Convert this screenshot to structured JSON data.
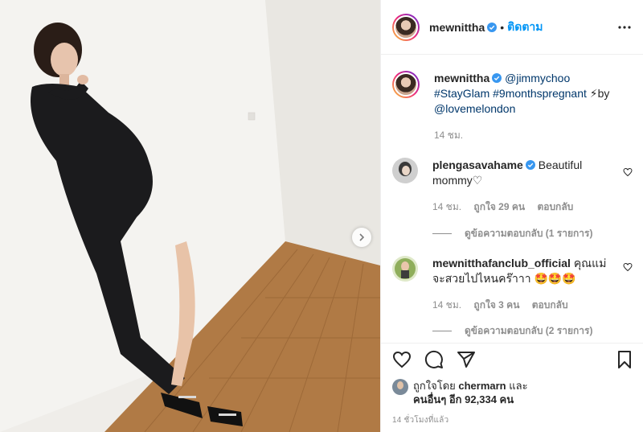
{
  "post": {
    "username": "mewnittha",
    "follow_label": "ติดตาม",
    "dot": "•"
  },
  "caption": {
    "username": "mewnittha",
    "mention": "@jimmychoo",
    "hashtags": "#StayGlam #9monthspregnant",
    "by_text": "by",
    "credit": "@lovemelondon",
    "emoji": "⚡",
    "time": "14 ชม."
  },
  "comments": [
    {
      "username": "plengasavahame",
      "text": "Beautiful mommy♡",
      "time": "14 ชม.",
      "likes": "ถูกใจ 29 คน",
      "reply_label": "ตอบกลับ",
      "view_replies": "ดูข้อความตอบกลับ (1 รายการ)"
    },
    {
      "username": "mewnitthafanclub_official",
      "text": "คุณแม่จะสวยไปไหนคร๊าาา 🤩🤩🤩",
      "time": "14 ชม.",
      "likes": "ถูกใจ 3 คน",
      "reply_label": "ตอบกลับ",
      "view_replies": "ดูข้อความตอบกลับ (2 รายการ)"
    }
  ],
  "likes": {
    "prefix": "ถูกใจโดย",
    "user": "chermarn",
    "and": "และ",
    "others": "คนอื่นๆ อีก 92,334 คน"
  },
  "posted": "14 ชั่วโมงที่แล้ว",
  "icons": {
    "like": "heart-icon",
    "comment": "comment-icon",
    "share": "share-icon",
    "save": "bookmark-icon",
    "more": "more-icon",
    "next": "chevron-right-icon",
    "verified": "verified-badge-icon"
  },
  "colors": {
    "link": "#00376b",
    "follow": "#0095f6",
    "muted": "#8e8e8e",
    "verified": "#3897f0"
  }
}
